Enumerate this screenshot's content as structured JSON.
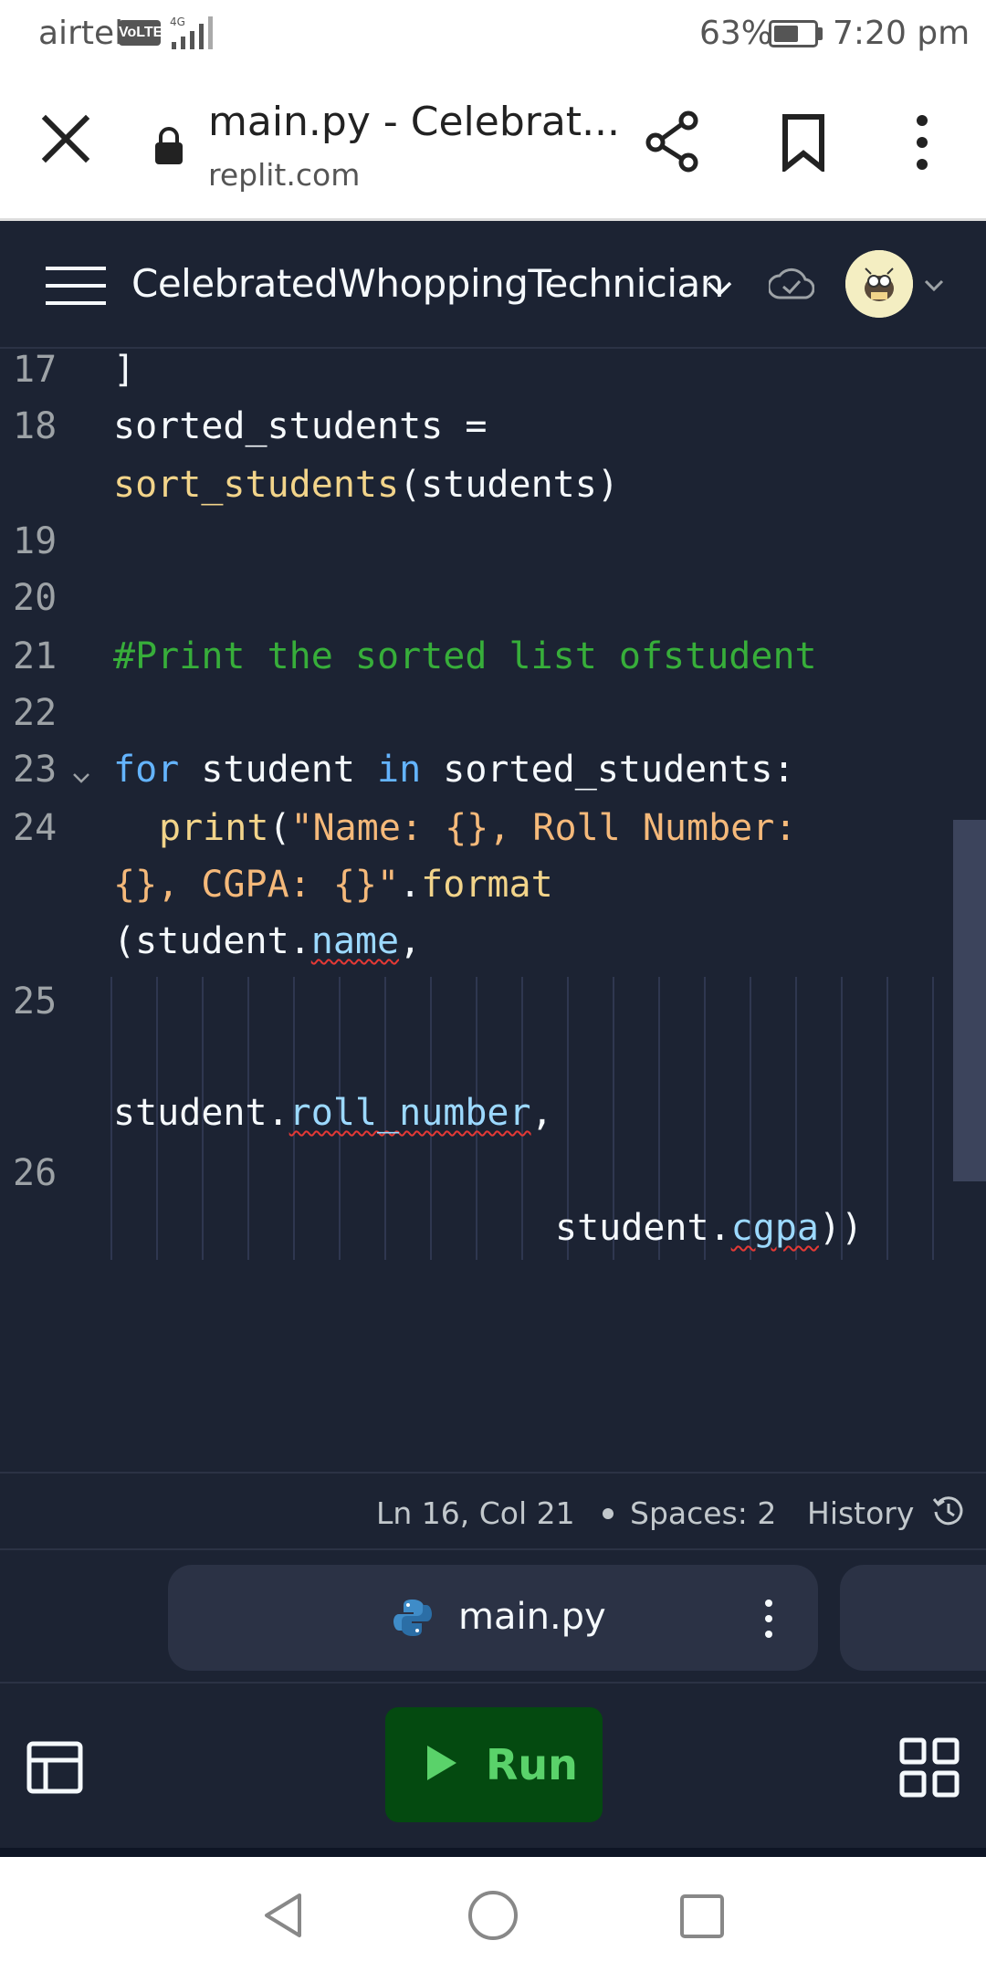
{
  "status_bar": {
    "carrier": "airtel",
    "volte": "VoLTE",
    "network": "4G",
    "battery": "63%",
    "time": "7:20 pm"
  },
  "browser": {
    "title": "main.py - Celebrat...",
    "url": "replit.com",
    "icons": [
      "close-icon",
      "lock-icon",
      "share-icon",
      "bookmark-icon",
      "more-vert-icon"
    ]
  },
  "header": {
    "repl_name": "CelebratedWhoppingTechnician",
    "icons": [
      "hamburger-menu-icon",
      "chevron-down-icon",
      "saved-check-icon",
      "avatar"
    ]
  },
  "editor": {
    "line_numbers": [
      "17",
      "18",
      "19",
      "20",
      "21",
      "22",
      "23",
      "24",
      "25",
      "26"
    ],
    "lines": {
      "l17": "]",
      "l18a": "sorted_students =",
      "l18b_fn": "sort_students",
      "l18b_rest": "(students)",
      "l21": "#Print the sorted list ofstudent",
      "l23_kw1": "for",
      "l23_mid": " student ",
      "l23_kw2": "in",
      "l23_rest": " sorted_students:",
      "l24a_fn": "print",
      "l24a_p": "(",
      "l24a_str": "\"Name: {}, Roll Number:",
      "l24b_str": "{}, CGPA: {}\"",
      "l24b_dot": ".",
      "l24b_fn": "format",
      "l24c_p": "(student.",
      "l24c_attr": "name",
      "l24c_end": ",",
      "l25_obj": "student.",
      "l25_attr": "roll_number",
      "l25_end": ",",
      "l26_obj": "student.",
      "l26_attr": "cgpa",
      "l26_end": "))"
    }
  },
  "status_line": {
    "position": "Ln 16, Col 21",
    "spaces": "Spaces: 2",
    "history": "History"
  },
  "tabs": [
    {
      "label": "main.py",
      "icon": "python-icon"
    }
  ],
  "run": {
    "label": "Run",
    "accent": "#5ad26a",
    "background": "#044a10"
  },
  "colors": {
    "editor_bg": "#1c2333",
    "keyword": "#64b4ff",
    "function": "#f2d48a",
    "string": "#f5b97a",
    "comment": "#37ae3a"
  },
  "android_nav": [
    "back-icon",
    "home-icon",
    "recents-icon"
  ]
}
